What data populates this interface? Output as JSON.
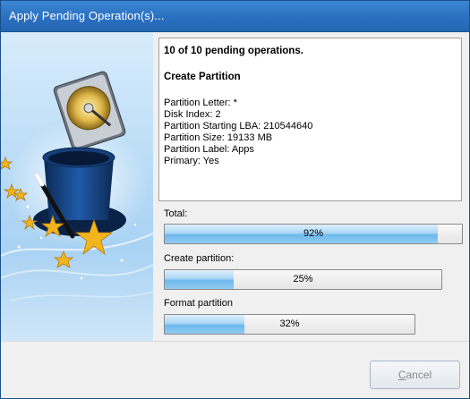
{
  "window": {
    "title": "Apply Pending Operation(s)..."
  },
  "details": {
    "heading": "10 of 10 pending operations.",
    "operation_title": "Create Partition",
    "lines": [
      "Partition Letter: *",
      "Disk Index: 2",
      "Partition Starting LBA: 210544640",
      "Partition Size: 19133 MB",
      "Partition Label: Apps",
      "Primary: Yes"
    ]
  },
  "progress": {
    "total": {
      "label": "Total:",
      "value": 92,
      "text": "92%"
    },
    "create": {
      "label": "Create partition:",
      "value": 25,
      "text": "25%"
    },
    "format": {
      "label": "Format partition",
      "value": 32,
      "text": "32%"
    }
  },
  "footer": {
    "cancel_label_first": "C",
    "cancel_label_rest": "ancel"
  },
  "illustration": {
    "icon": "magic-hat-with-hard-disk-and-stars-icon",
    "accent": "#2a70c0"
  }
}
